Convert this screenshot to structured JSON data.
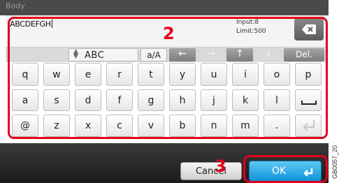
{
  "header": {
    "field_label": "Body"
  },
  "input": {
    "value": "ABCDEFGH",
    "counter_input": "Input:8",
    "counter_limit": "Limit:500"
  },
  "toolbar": {
    "mode_label": "ABC",
    "case_toggle": "a/A",
    "delete_label": "Del."
  },
  "keyboard": {
    "row1": [
      "q",
      "w",
      "e",
      "r",
      "t",
      "y",
      "u",
      "i",
      "o",
      "p"
    ],
    "row2": [
      "a",
      "s",
      "d",
      "f",
      "g",
      "h",
      "j",
      "k",
      "l"
    ],
    "row3": [
      "@",
      "z",
      "x",
      "c",
      "v",
      "b",
      "n",
      "m",
      "."
    ]
  },
  "footer": {
    "cancel_label": "Cancel",
    "ok_label": "OK"
  },
  "callouts": {
    "step2": "2",
    "step3": "3"
  },
  "figure_code": "GB0057_20",
  "colors": {
    "callout": "#e2001a",
    "ok_button": "#1a9ee0",
    "toolbar": "#d9d9d9"
  },
  "icons": [
    "backspace-icon",
    "updown-icon",
    "arrow-left-icon",
    "arrow-right-icon",
    "arrow-up-icon",
    "arrow-down-icon",
    "space-icon",
    "enter-icon"
  ]
}
